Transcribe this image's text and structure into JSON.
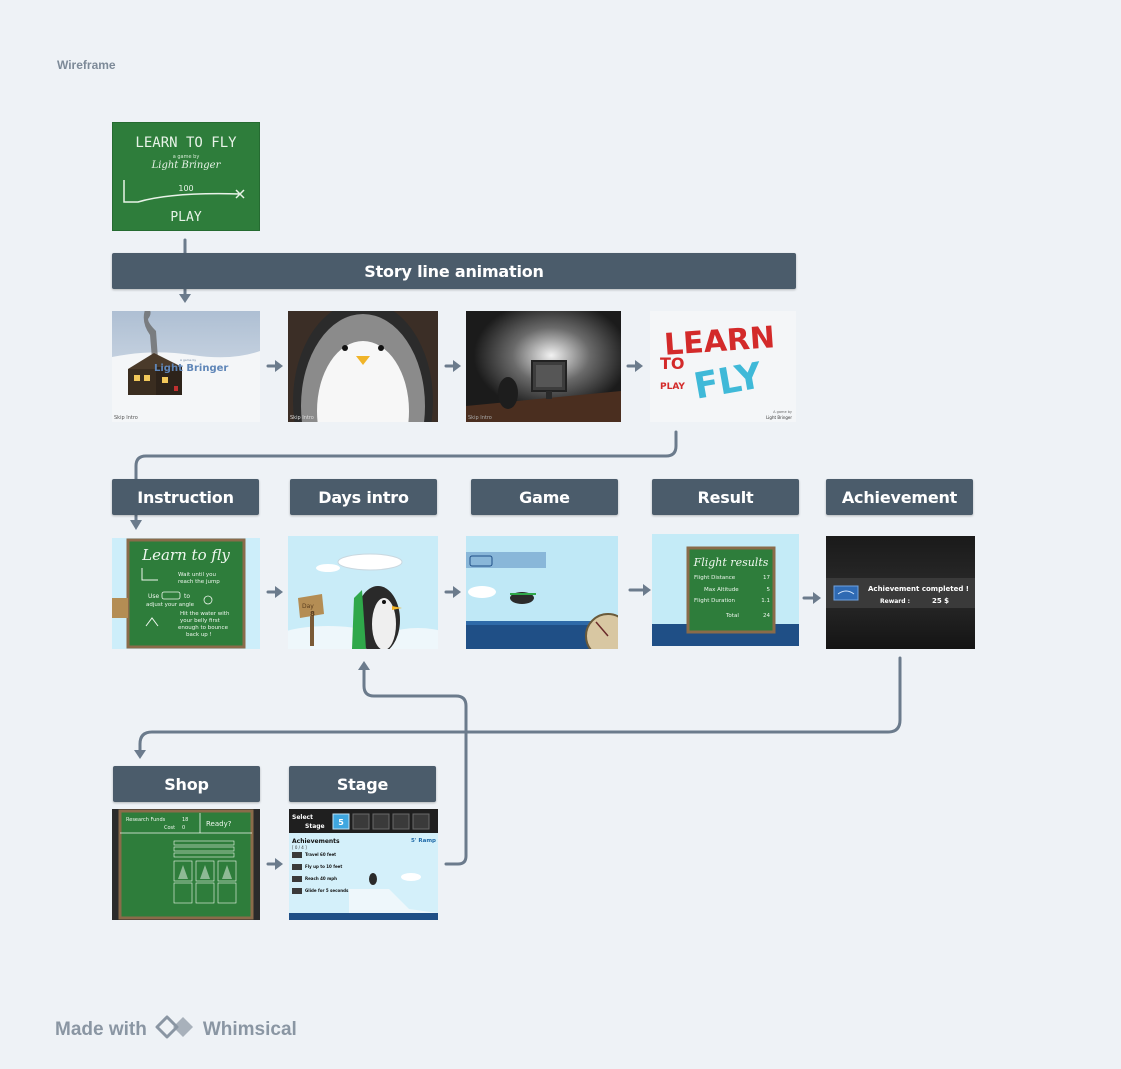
{
  "frame": {
    "label": "Wireframe"
  },
  "headers": {
    "story": "Story line animation",
    "instruction": "Instruction",
    "days_intro": "Days intro",
    "game": "Game",
    "result": "Result",
    "achievement": "Achievement",
    "shop": "Shop",
    "stage": "Stage"
  },
  "thumbs": {
    "title": {
      "line1": "LEARN TO FLY",
      "line2": "a game by",
      "line3": "Light Bringer",
      "score": "100",
      "play": "PLAY"
    },
    "intro1": {
      "brand": "Light Bringer",
      "brand_small": "A game by",
      "skip": "Skip Intro"
    },
    "intro2": {
      "skip": "Skip Intro"
    },
    "intro3": {
      "skip": "Skip Intro"
    },
    "logo": {
      "word1": "LEARN",
      "word2": "FLY",
      "word3": "TO",
      "play": "PLAY",
      "credit1": "A game by",
      "credit2": "Light Bringer"
    },
    "instruction": {
      "title": "Learn to fly",
      "t1": "Wait until you",
      "t2": "reach the jump",
      "t3": "Use",
      "t4": "to",
      "t5": "adjust your angle",
      "t6": "Hit the water with",
      "t7": "your belly first",
      "t8": "enough to bounce",
      "t9": "back up !"
    },
    "days": {
      "day": "Day",
      "num": "8"
    },
    "result": {
      "title": "Flight results",
      "r1": "Flight Distance",
      "v1": "17",
      "r2": "Max Altitude",
      "v2": "5",
      "r3": "Flight Duration",
      "v3": "1.1",
      "r4": "Total",
      "v4": "24"
    },
    "achievement": {
      "title": "Achievement completed !",
      "reward_label": "Reward :",
      "reward_value": "25 $"
    },
    "shop": {
      "l1": "Research Funds",
      "v1": "18",
      "l2": "Cost",
      "v2": "0",
      "ready": "Ready?"
    },
    "stage": {
      "select1": "Select",
      "select2": "Stage",
      "num": "5",
      "ramp": "5' Ramp",
      "ach": "Achievements",
      "frac": "[ 0 / 4 ]",
      "a1": "Travel 60 feet",
      "a2": "Fly up to 10 feet",
      "a3": "Reach 40 mph",
      "a4": "Glide for 5 seconds"
    }
  },
  "footer": {
    "made_with": "Made with",
    "brand": "Whimsical"
  },
  "colors": {
    "header_bg": "#4b5c6b",
    "connector": "#6b7b8c",
    "canvas": "#ffffff",
    "page": "#eef2f6",
    "chalkboard": "#2e7d3b"
  }
}
